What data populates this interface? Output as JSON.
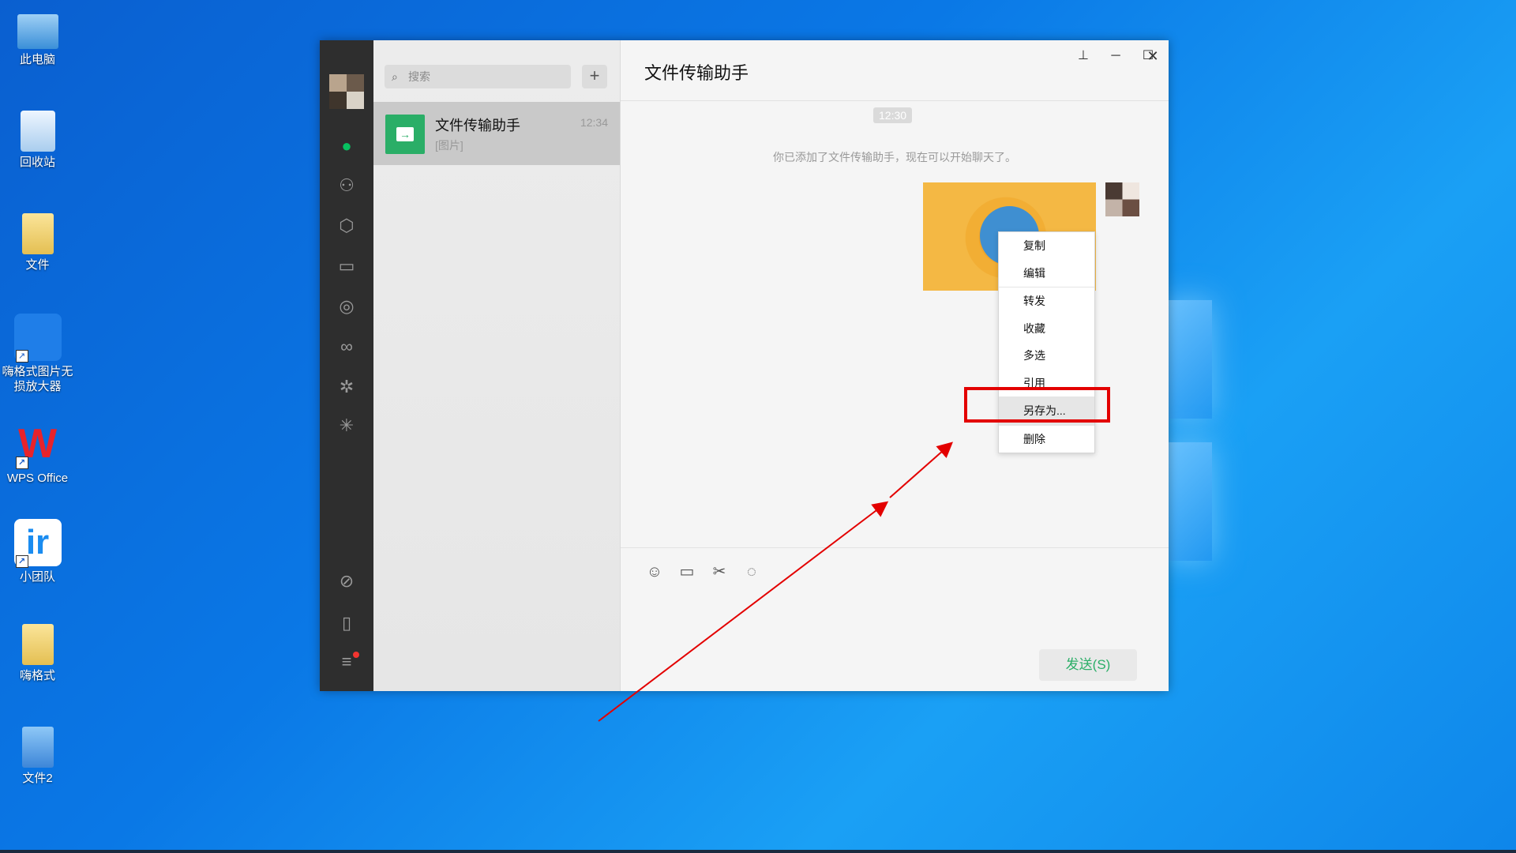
{
  "desktop": {
    "icons": [
      {
        "label": "此电脑",
        "icon": "computer-icon"
      },
      {
        "label": "回收站",
        "icon": "recycle-bin-icon"
      },
      {
        "label": "文件",
        "icon": "folder-icon"
      },
      {
        "label": "嗨格式图片无损放大器",
        "icon": "owl-app-icon"
      },
      {
        "label": "WPS Office",
        "icon": "wps-icon"
      },
      {
        "label": "小团队",
        "icon": "team-app-icon"
      },
      {
        "label": "嗨格式",
        "icon": "folder-icon"
      },
      {
        "label": "文件2",
        "icon": "folder-icon"
      }
    ]
  },
  "wechat": {
    "search_placeholder": "搜索",
    "chat_list": [
      {
        "name": "文件传输助手",
        "time": "12:34",
        "preview": "[图片]"
      }
    ],
    "conversation": {
      "title": "文件传输助手",
      "time_badge": "12:30",
      "system_message": "你已添加了文件传输助手，现在可以开始聊天了。"
    },
    "send_label": "发送(S)",
    "context_menu": [
      "复制",
      "编辑",
      "转发",
      "收藏",
      "多选",
      "引用",
      "另存为...",
      "删除"
    ],
    "highlighted_item": "另存为...",
    "accent_color": "#2aae67",
    "highlight_color": "#e30000"
  }
}
